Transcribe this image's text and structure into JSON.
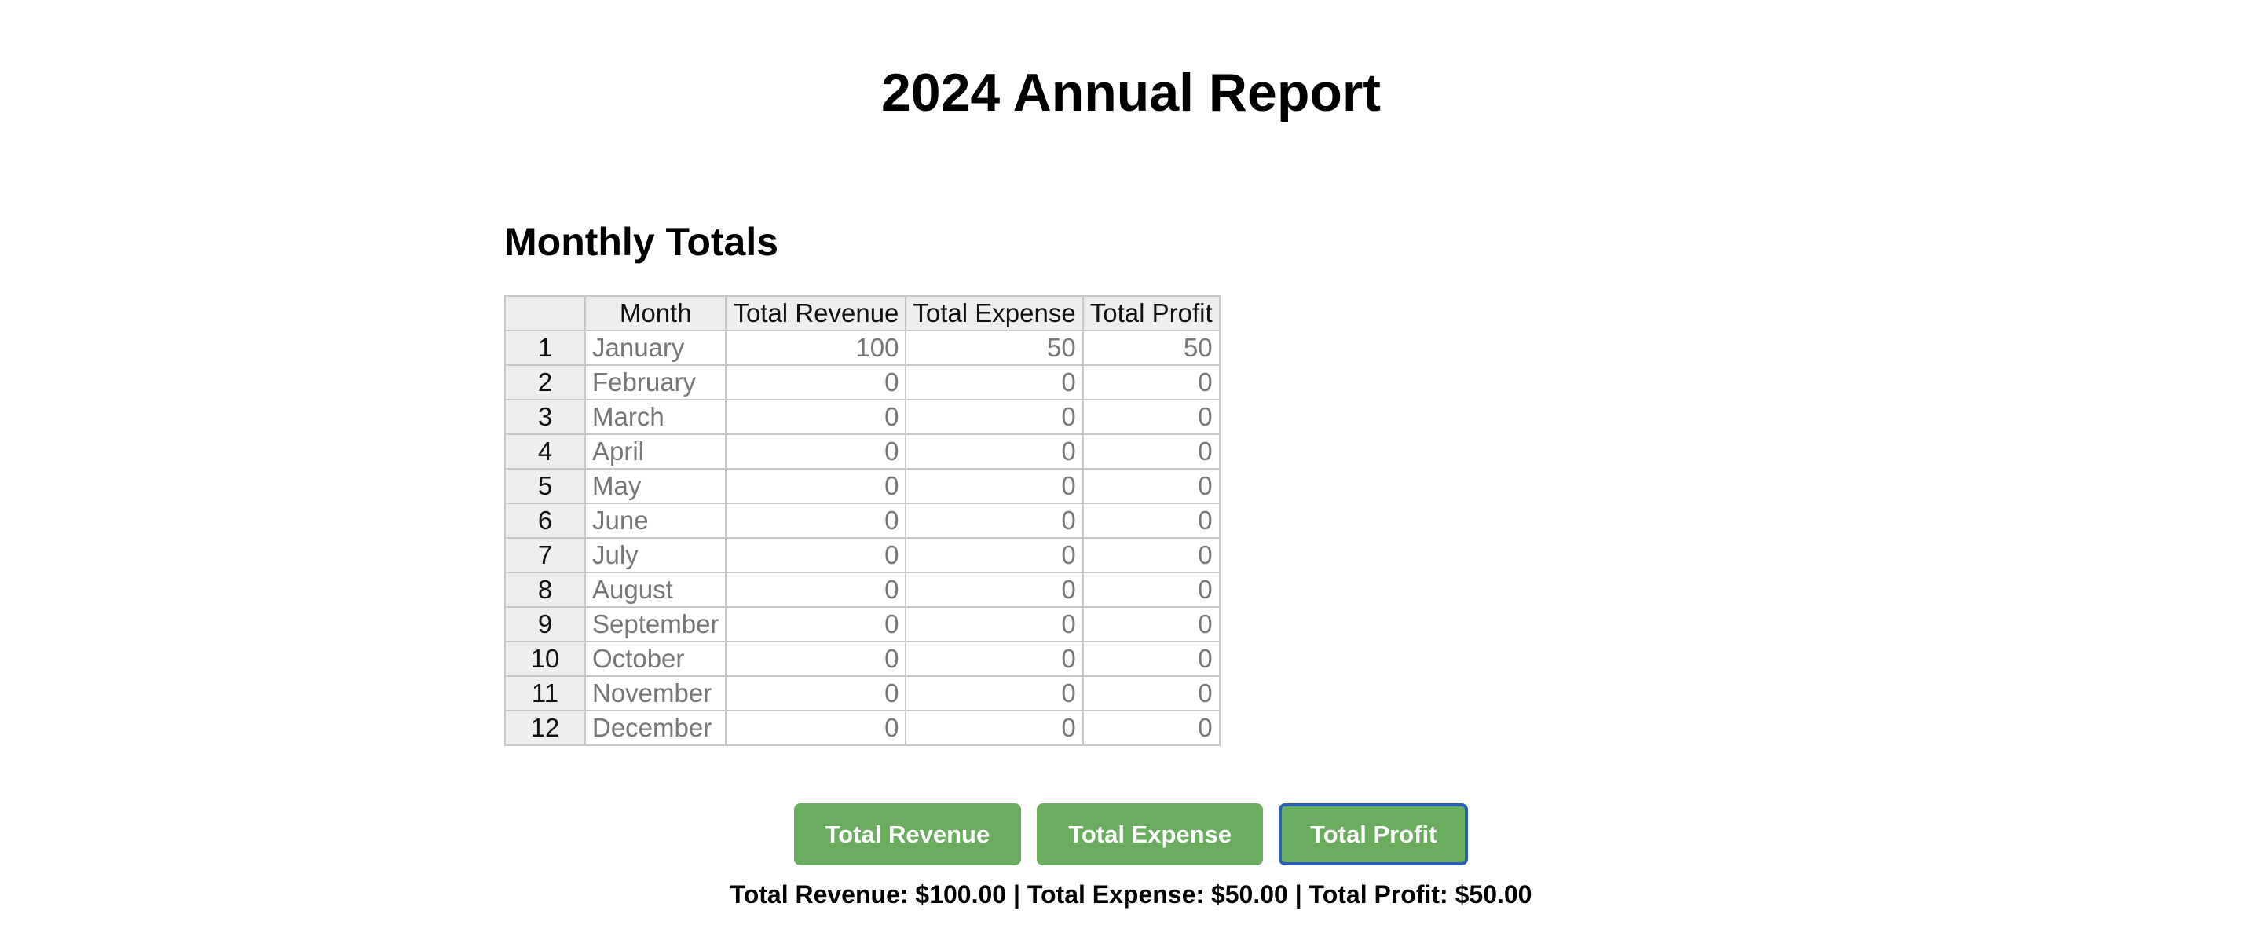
{
  "page": {
    "title": "2024 Annual Report",
    "section_title": "Monthly Totals"
  },
  "table": {
    "headers": [
      "",
      "Month",
      "Total Revenue",
      "Total Expense",
      "Total Profit"
    ],
    "rows": [
      {
        "index": "1",
        "month": "January",
        "revenue": "100",
        "expense": "50",
        "profit": "50"
      },
      {
        "index": "2",
        "month": "February",
        "revenue": "0",
        "expense": "0",
        "profit": "0"
      },
      {
        "index": "3",
        "month": "March",
        "revenue": "0",
        "expense": "0",
        "profit": "0"
      },
      {
        "index": "4",
        "month": "April",
        "revenue": "0",
        "expense": "0",
        "profit": "0"
      },
      {
        "index": "5",
        "month": "May",
        "revenue": "0",
        "expense": "0",
        "profit": "0"
      },
      {
        "index": "6",
        "month": "June",
        "revenue": "0",
        "expense": "0",
        "profit": "0"
      },
      {
        "index": "7",
        "month": "July",
        "revenue": "0",
        "expense": "0",
        "profit": "0"
      },
      {
        "index": "8",
        "month": "August",
        "revenue": "0",
        "expense": "0",
        "profit": "0"
      },
      {
        "index": "9",
        "month": "September",
        "revenue": "0",
        "expense": "0",
        "profit": "0"
      },
      {
        "index": "10",
        "month": "October",
        "revenue": "0",
        "expense": "0",
        "profit": "0"
      },
      {
        "index": "11",
        "month": "November",
        "revenue": "0",
        "expense": "0",
        "profit": "0"
      },
      {
        "index": "12",
        "month": "December",
        "revenue": "0",
        "expense": "0",
        "profit": "0"
      }
    ]
  },
  "buttons": {
    "revenue_label": "Total Revenue",
    "expense_label": "Total Expense",
    "profit_label": "Total Profit",
    "focused": "profit"
  },
  "summary": {
    "text": "Total Revenue: $100.00 | Total Expense: $50.00 | Total Profit: $50.00"
  },
  "colors": {
    "button_green": "#6aad5e",
    "focus_ring": "#2b5fb4",
    "header_bg": "#eeeeee",
    "grid_border": "#c8c8c8",
    "cell_text": "#777777"
  }
}
